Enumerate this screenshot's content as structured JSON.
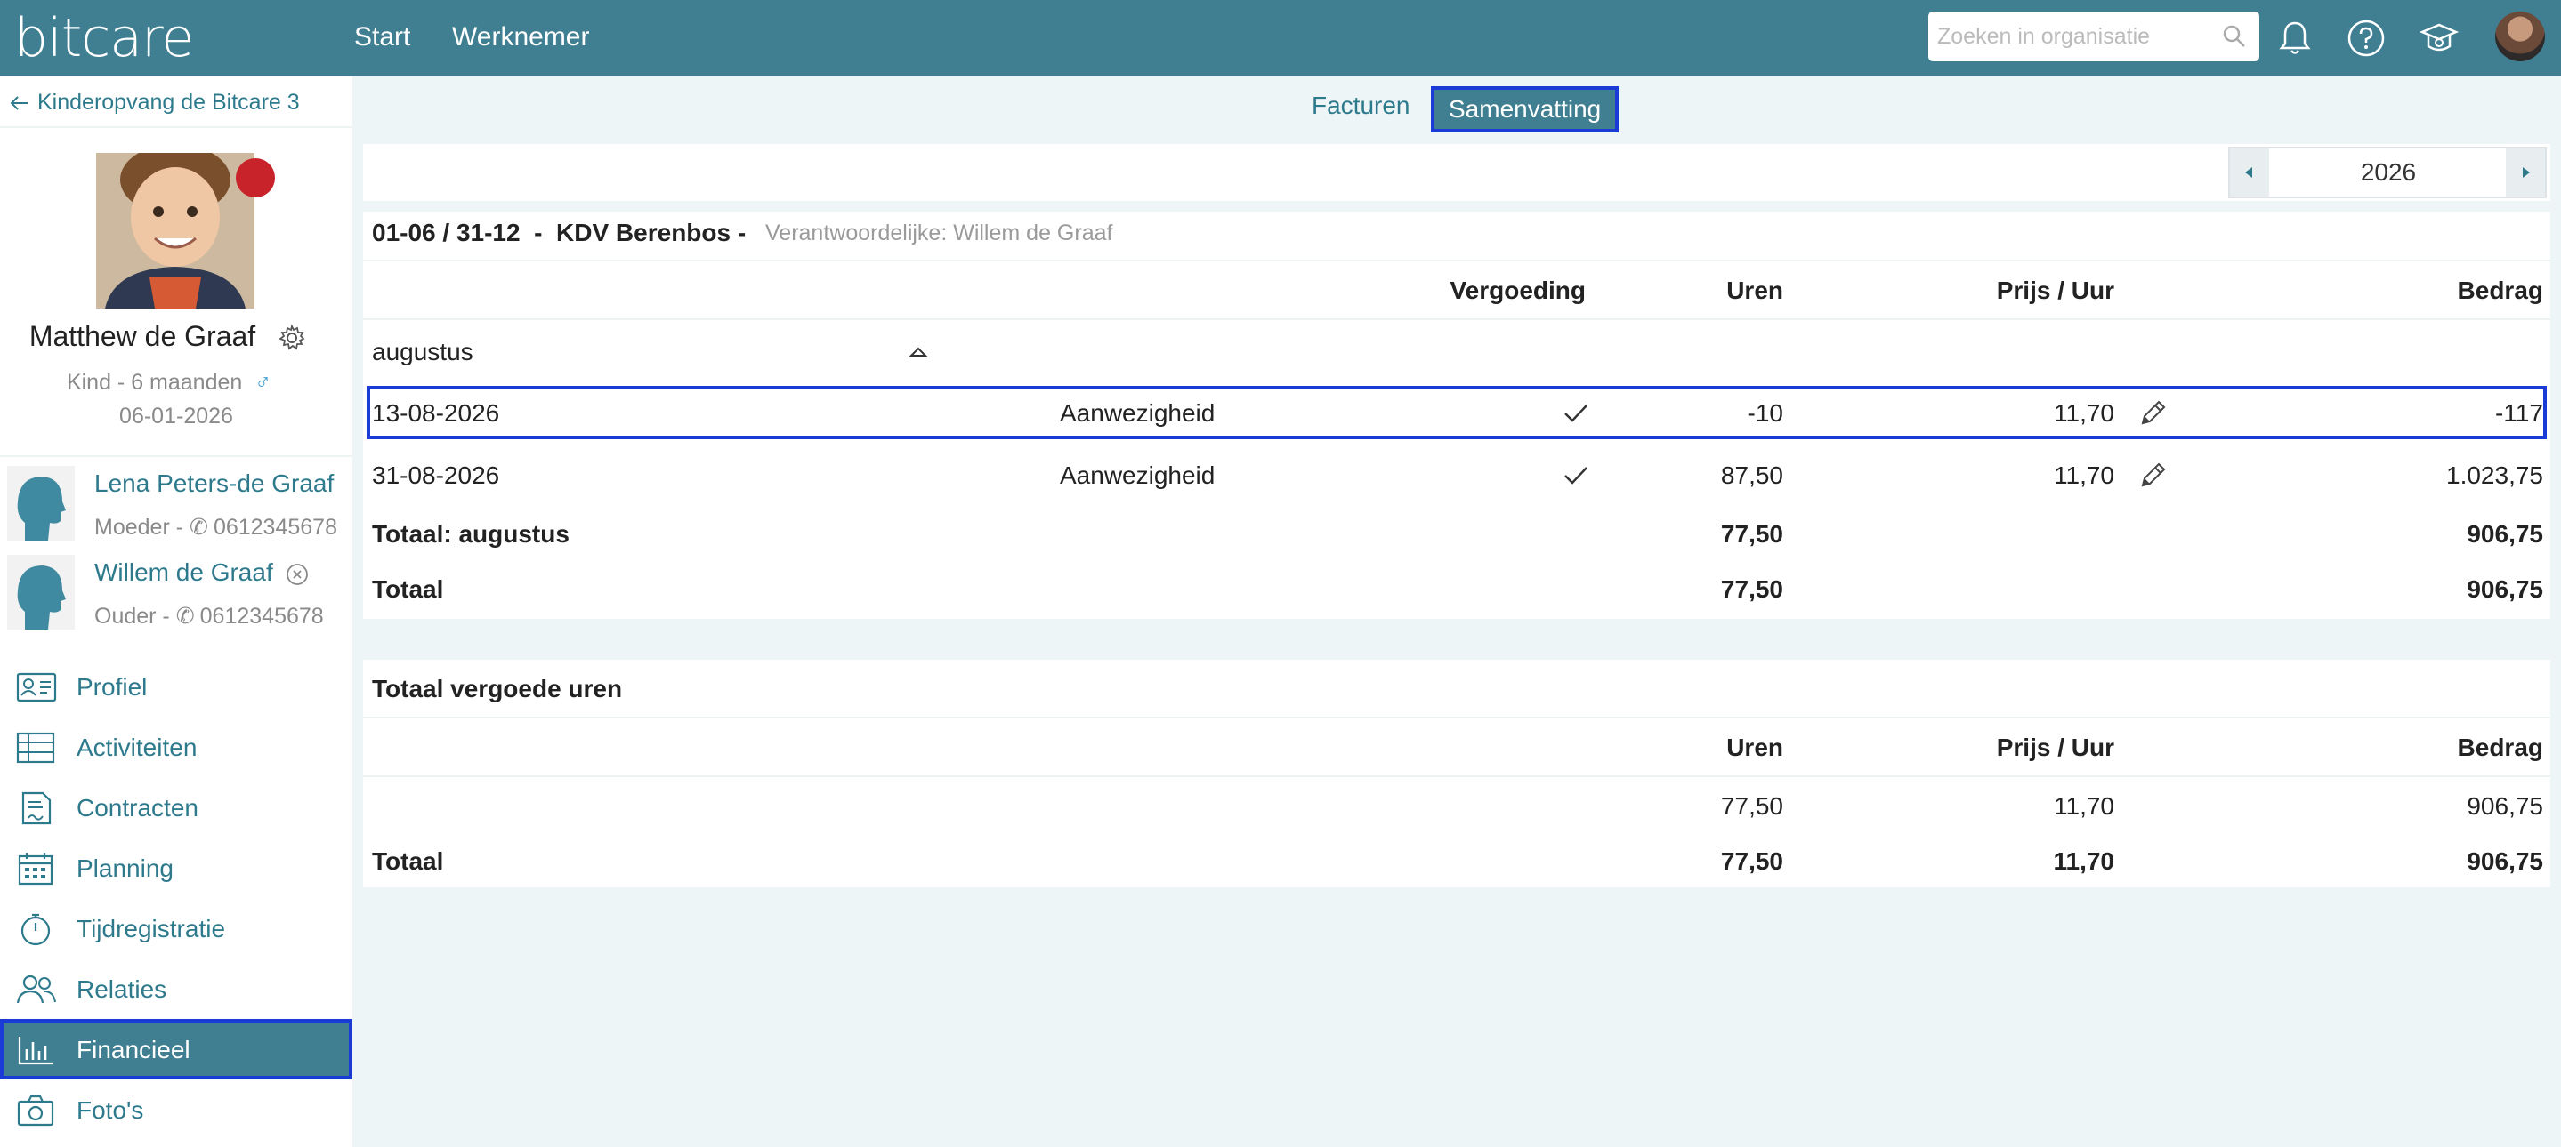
{
  "app": {
    "logo": "bitcare",
    "nav": [
      "Start",
      "Werknemer"
    ],
    "search_placeholder": "Zoeken in organisatie"
  },
  "sidebar": {
    "back_label": "Kinderopvang de Bitcare 3",
    "child": {
      "name": "Matthew de Graaf",
      "subtitle": "Kind - 6 maanden",
      "birthdate": "06-01-2026"
    },
    "relations": [
      {
        "name": "Lena Peters-de Graaf",
        "sub": "Moeder - ",
        "phone": "0612345678"
      },
      {
        "name": "Willem de Graaf",
        "sub": "Ouder - ",
        "phone": "0612345678"
      }
    ],
    "menu": [
      {
        "label": "Profiel",
        "icon": "profile-card-icon"
      },
      {
        "label": "Activiteiten",
        "icon": "table-icon"
      },
      {
        "label": "Contracten",
        "icon": "contract-icon"
      },
      {
        "label": "Planning",
        "icon": "calendar-icon"
      },
      {
        "label": "Tijdregistratie",
        "icon": "stopwatch-icon"
      },
      {
        "label": "Relaties",
        "icon": "people-icon"
      },
      {
        "label": "Financieel",
        "icon": "bar-chart-icon",
        "active": true
      },
      {
        "label": "Foto's",
        "icon": "camera-icon"
      }
    ]
  },
  "tabs": [
    {
      "label": "Facturen",
      "active": false
    },
    {
      "label": "Samenvatting",
      "active": true
    }
  ],
  "year": "2026",
  "contract": {
    "period": "01-06 / 31-12",
    "sep": "-",
    "location": "KDV Berenbos -",
    "responsible": "Verantwoordelijke: Willem de Graaf"
  },
  "table": {
    "headers": {
      "vergoeding": "Vergoeding",
      "uren": "Uren",
      "prijs": "Prijs / Uur",
      "bedrag": "Bedrag"
    },
    "month": "augustus",
    "rows": [
      {
        "date": "13-08-2026",
        "type": "Aanwezigheid",
        "uren": "-10",
        "prijs": "11,70",
        "bedrag": "-117"
      },
      {
        "date": "31-08-2026",
        "type": "Aanwezigheid",
        "uren": "87,50",
        "prijs": "11,70",
        "bedrag": "1.023,75"
      }
    ],
    "subtotal": {
      "label": "Totaal: augustus",
      "uren": "77,50",
      "bedrag": "906,75"
    },
    "total": {
      "label": "Totaal",
      "uren": "77,50",
      "bedrag": "906,75"
    }
  },
  "vergoed": {
    "title": "Totaal vergoede uren",
    "headers": {
      "uren": "Uren",
      "prijs": "Prijs / Uur",
      "bedrag": "Bedrag"
    },
    "row": {
      "uren": "77,50",
      "prijs": "11,70",
      "bedrag": "906,75"
    },
    "total": {
      "label": "Totaal",
      "uren": "77,50",
      "prijs": "11,70",
      "bedrag": "906,75"
    }
  },
  "colors": {
    "brand": "#3f7f91",
    "link": "#2e7a8d",
    "highlight": "#1a3bd6",
    "status": "#c8222a"
  }
}
